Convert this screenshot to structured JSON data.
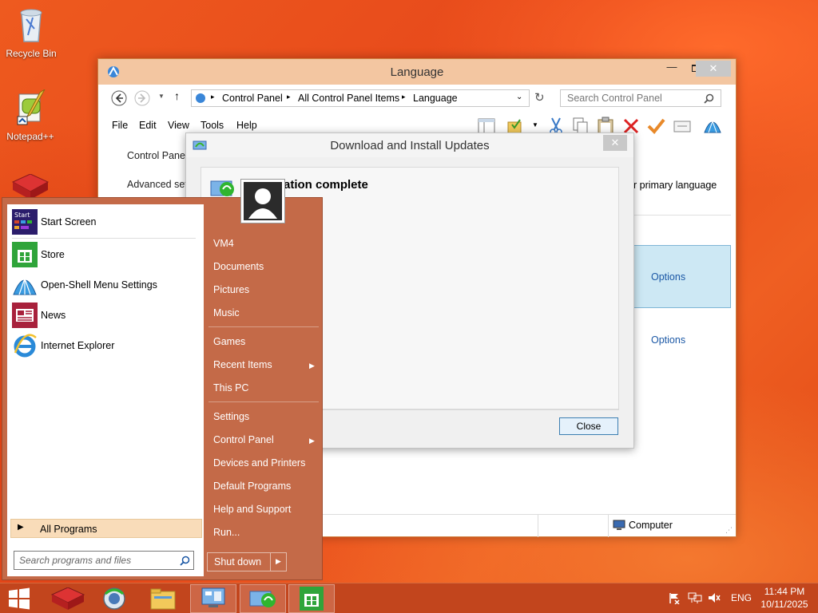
{
  "desktop": {
    "icons": [
      {
        "label": "Recycle Bin"
      },
      {
        "label": "Notepad++"
      }
    ]
  },
  "language_window": {
    "title": "Language",
    "address": {
      "segments": [
        "Control Panel",
        "All Control Panel Items",
        "Language"
      ]
    },
    "search_placeholder": "Search Control Panel",
    "menu": [
      "File",
      "Edit",
      "View",
      "Tools",
      "Help"
    ],
    "left_pane": [
      "Control Panel",
      "Advanced set"
    ],
    "content": {
      "primary_language_text": "r primary language",
      "options_1": "Options",
      "options_2": "Options"
    },
    "status": {
      "computer": "Computer"
    }
  },
  "dialog": {
    "title": "Download and Install Updates",
    "heading": "ation complete",
    "close_button": "Close",
    "close_x": "✕"
  },
  "start_menu": {
    "left_items": [
      {
        "label": "Start Screen",
        "icon": "start-screen-icon"
      },
      {
        "label": "Store",
        "icon": "store-icon"
      },
      {
        "label": "Open-Shell Menu Settings",
        "icon": "open-shell-icon"
      },
      {
        "label": "News",
        "icon": "news-icon"
      },
      {
        "label": "Internet Explorer",
        "icon": "internet-explorer-icon"
      }
    ],
    "start_tile_text": "Start",
    "all_programs": "All Programs",
    "search_placeholder": "Search programs and files",
    "right_items": [
      {
        "label": "VM4"
      },
      {
        "label": "Documents"
      },
      {
        "label": "Pictures"
      },
      {
        "label": "Music"
      },
      {
        "label": "Games"
      },
      {
        "label": "Recent Items"
      },
      {
        "label": "This PC"
      },
      {
        "label": "Settings"
      },
      {
        "label": "Control Panel"
      },
      {
        "label": "Devices and Printers"
      },
      {
        "label": "Default Programs"
      },
      {
        "label": "Help and Support"
      },
      {
        "label": "Run..."
      }
    ],
    "shutdown": "Shut down"
  },
  "taskbar": {
    "language": "ENG",
    "time": "11:44 PM",
    "date": "10/11/2025"
  },
  "colors": {
    "desktop": "#e84d1a",
    "taskbar": "#c2451d",
    "startmenu": "#c46a48",
    "titlebar": "#f3c6a1",
    "link": "#1a57a5"
  }
}
